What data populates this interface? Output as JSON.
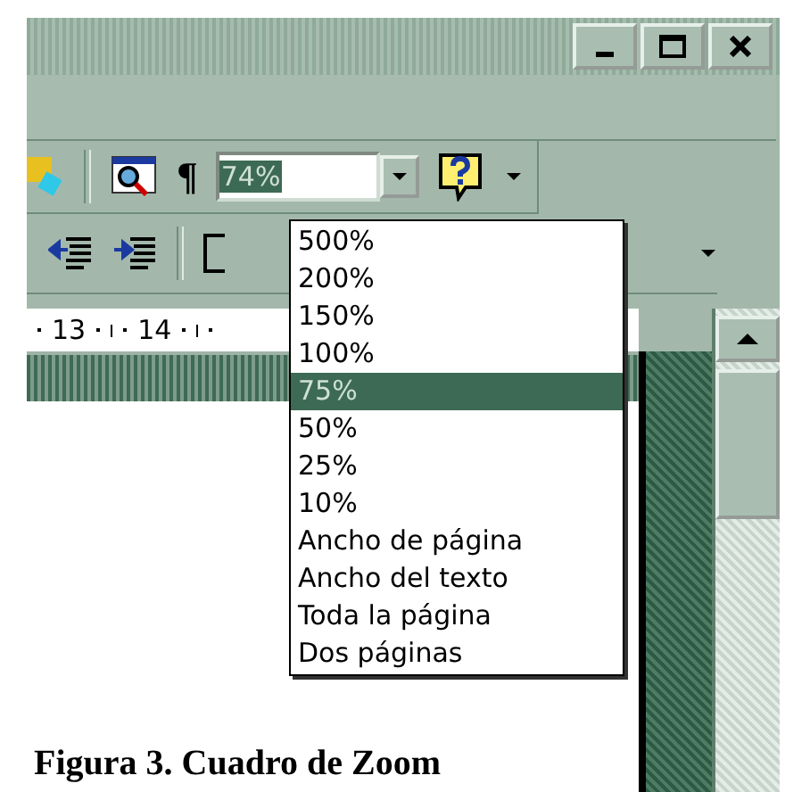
{
  "toolbar": {
    "pilcrow": "¶",
    "zoom_field": {
      "value": "74%",
      "highlighted": true
    }
  },
  "zoom_menu": {
    "items": [
      {
        "label": "500%",
        "selected": false
      },
      {
        "label": "200%",
        "selected": false
      },
      {
        "label": "150%",
        "selected": false
      },
      {
        "label": "100%",
        "selected": false
      },
      {
        "label": "75%",
        "selected": true
      },
      {
        "label": "50%",
        "selected": false
      },
      {
        "label": "25%",
        "selected": false
      },
      {
        "label": "10%",
        "selected": false
      },
      {
        "label": "Ancho de página",
        "selected": false
      },
      {
        "label": "Ancho del texto",
        "selected": false
      },
      {
        "label": "Toda la página",
        "selected": false
      },
      {
        "label": "Dos páginas",
        "selected": false
      }
    ]
  },
  "ruler": {
    "numbers": [
      "13",
      "14"
    ]
  },
  "caption": "Figura 3. Cuadro de Zoom"
}
